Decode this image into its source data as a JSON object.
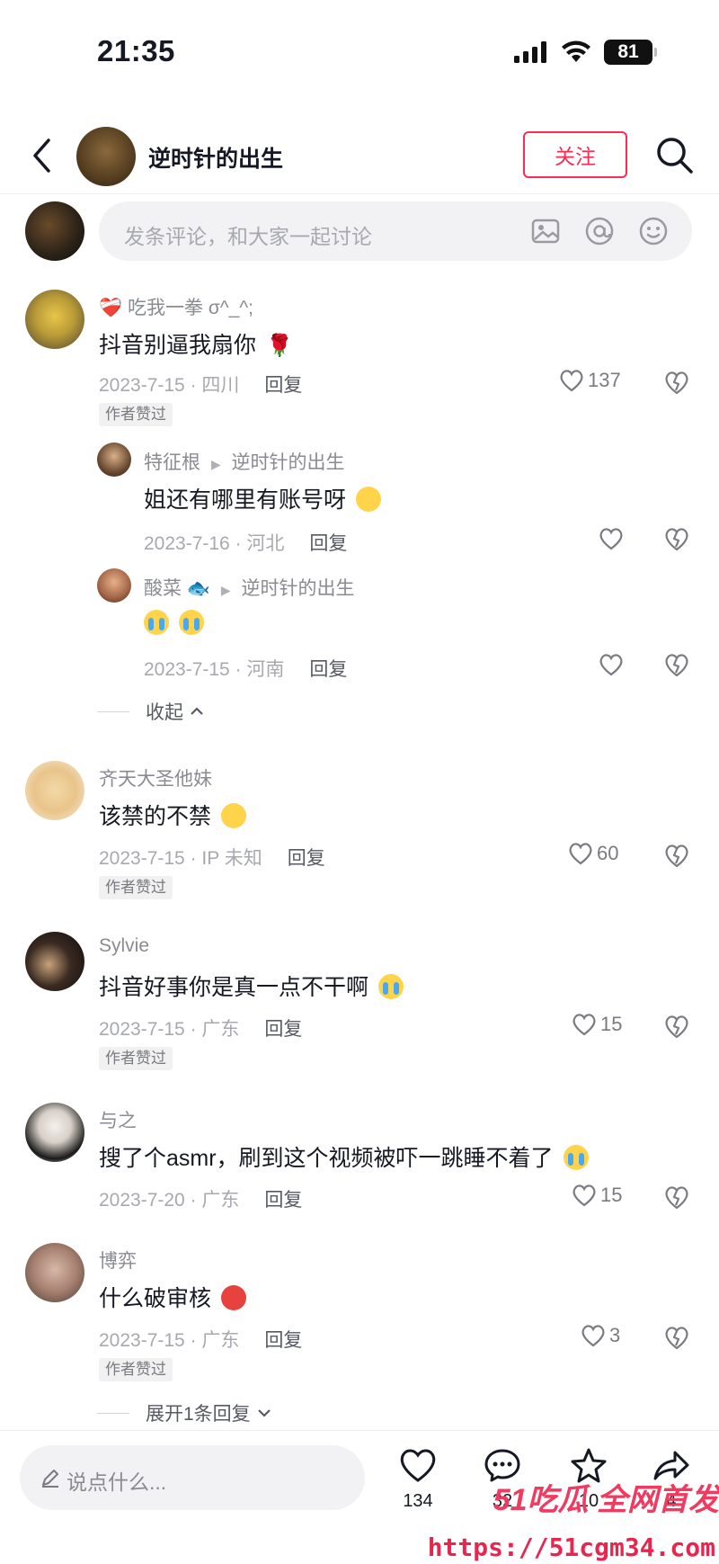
{
  "status_bar": {
    "time": "21:35",
    "battery": "81"
  },
  "header": {
    "title": "逆时针的出生",
    "follow_label": "关注"
  },
  "composer": {
    "placeholder": "发条评论，和大家一起讨论"
  },
  "comments": [
    {
      "user": "吃我一拳 σ^_^;",
      "text": "抖音别逼我扇你",
      "date_location": "2023-7-15 · 四川",
      "reply_label": "回复",
      "likes": "137",
      "badge": "作者赞过",
      "replies": [
        {
          "user": "特征根",
          "reply_to": "逆时针的出生",
          "text": "姐还有哪里有账号呀",
          "date_location": "2023-7-16 · 河北",
          "reply_label": "回复"
        },
        {
          "user": "酸菜",
          "reply_to": "逆时针的出生",
          "text": "",
          "date_location": "2023-7-15 · 河南",
          "reply_label": "回复"
        }
      ],
      "collapse_label": "收起"
    },
    {
      "user": "齐天大圣他妹",
      "text": "该禁的不禁",
      "date_location": "2023-7-15 · IP 未知",
      "reply_label": "回复",
      "likes": "60",
      "badge": "作者赞过"
    },
    {
      "user": "Sylvie",
      "text": "抖音好事你是真一点不干啊",
      "date_location": "2023-7-15 · 广东",
      "reply_label": "回复",
      "likes": "15",
      "badge": "作者赞过"
    },
    {
      "user": "与之",
      "text": "搜了个asmr，刷到这个视频被吓一跳睡不着了",
      "date_location": "2023-7-20 · 广东",
      "reply_label": "回复",
      "likes": "15"
    },
    {
      "user": "博弈",
      "text": "什么破审核",
      "date_location": "2023-7-15 · 广东",
      "reply_label": "回复",
      "likes": "3",
      "badge": "作者赞过",
      "expand_label": "展开1条回复"
    }
  ],
  "bottom_bar": {
    "placeholder": "说点什么...",
    "like_count": "134",
    "comment_count": "32",
    "favorite_count": "10",
    "share_count": "4"
  },
  "watermark": {
    "brand": "51吃瓜 全网首发",
    "url": "https://51cgm34.com"
  },
  "colors": {
    "accent": "#fe2c55",
    "text": "#161823",
    "secondary": "#8a8b91"
  }
}
